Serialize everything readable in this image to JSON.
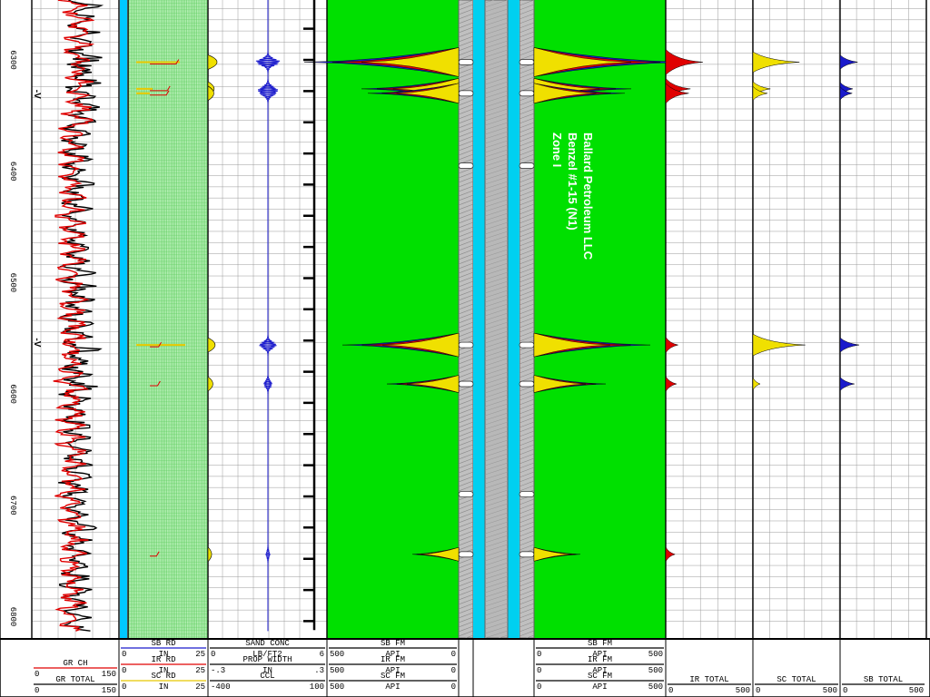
{
  "chart_data": {
    "type": "line",
    "depth_ticks": [
      "6300",
      "6400",
      "6500",
      "6600",
      "6700",
      "6800"
    ],
    "annotation": [
      "Ballard Petroleum LLC",
      "Benzel #1-15 (N1)",
      "Zone I"
    ],
    "zone_markers": [
      {
        "label": "-V",
        "depth": 6330
      },
      {
        "label": "-V",
        "depth": 6553
      }
    ],
    "header": {
      "track1": [
        {
          "name": "GR CH",
          "min": "0",
          "max": "150",
          "color": "#e00000"
        },
        {
          "name": "GR TOTAL",
          "min": "0",
          "max": "150",
          "color": "#000000"
        }
      ],
      "track2": [
        {
          "name": "SB RD",
          "min": "0",
          "unit": "IN",
          "max": "25",
          "color": "#1a1acc"
        },
        {
          "name": "IR RD",
          "min": "0",
          "unit": "IN",
          "max": "25",
          "color": "#e00000"
        },
        {
          "name": "SC RD",
          "min": "0",
          "unit": "IN",
          "max": "25",
          "color": "#e8c800"
        }
      ],
      "track3": [
        {
          "name": "SAND CONC",
          "min": "0",
          "unit": "LB/FT2",
          "max": "6"
        },
        {
          "name": "PROP WIDTH",
          "min": "-.3",
          "unit": "IN",
          "max": ".3"
        },
        {
          "name": "CCL",
          "min": "-400",
          "max": "100"
        }
      ],
      "track4": [
        {
          "name": "SB FM",
          "min": "500",
          "unit": "API",
          "max": "0"
        },
        {
          "name": "IR FM",
          "min": "500",
          "unit": "API",
          "max": "0"
        },
        {
          "name": "SC FM",
          "min": "500",
          "unit": "API",
          "max": "0"
        }
      ],
      "track5": [
        {
          "name": "SB FM",
          "min": "0",
          "unit": "API",
          "max": "500"
        },
        {
          "name": "IR FM",
          "min": "0",
          "unit": "API",
          "max": "500"
        },
        {
          "name": "SC FM",
          "min": "0",
          "unit": "API",
          "max": "500"
        }
      ],
      "track6": [
        {
          "name": "IR TOTAL",
          "min": "0",
          "max": "500"
        }
      ],
      "track7": [
        {
          "name": "SC TOTAL",
          "min": "0",
          "max": "500"
        }
      ],
      "track8": [
        {
          "name": "SB TOTAL",
          "min": "0",
          "max": "500"
        }
      ]
    },
    "ylim": [
      6244,
      6813
    ],
    "events": [
      {
        "depth": 6302,
        "ir": 240,
        "sc": 160,
        "sb": 55,
        "fm": 1.0
      },
      {
        "depth": 6326,
        "ir": 160,
        "sc": 60,
        "sb": 40,
        "fm": 0.55
      },
      {
        "depth": 6330,
        "ir": 150,
        "sc": 50,
        "sb": 38,
        "fm": 0.5
      },
      {
        "depth": 6556,
        "ir": 80,
        "sc": 180,
        "sb": 60,
        "fm": 0.7
      },
      {
        "depth": 6591,
        "ir": 70,
        "sc": 25,
        "sb": 45,
        "fm": 0.35
      },
      {
        "depth": 6744,
        "ir": 60,
        "sc": 0,
        "sb": 0,
        "fm": 0.15
      }
    ]
  }
}
